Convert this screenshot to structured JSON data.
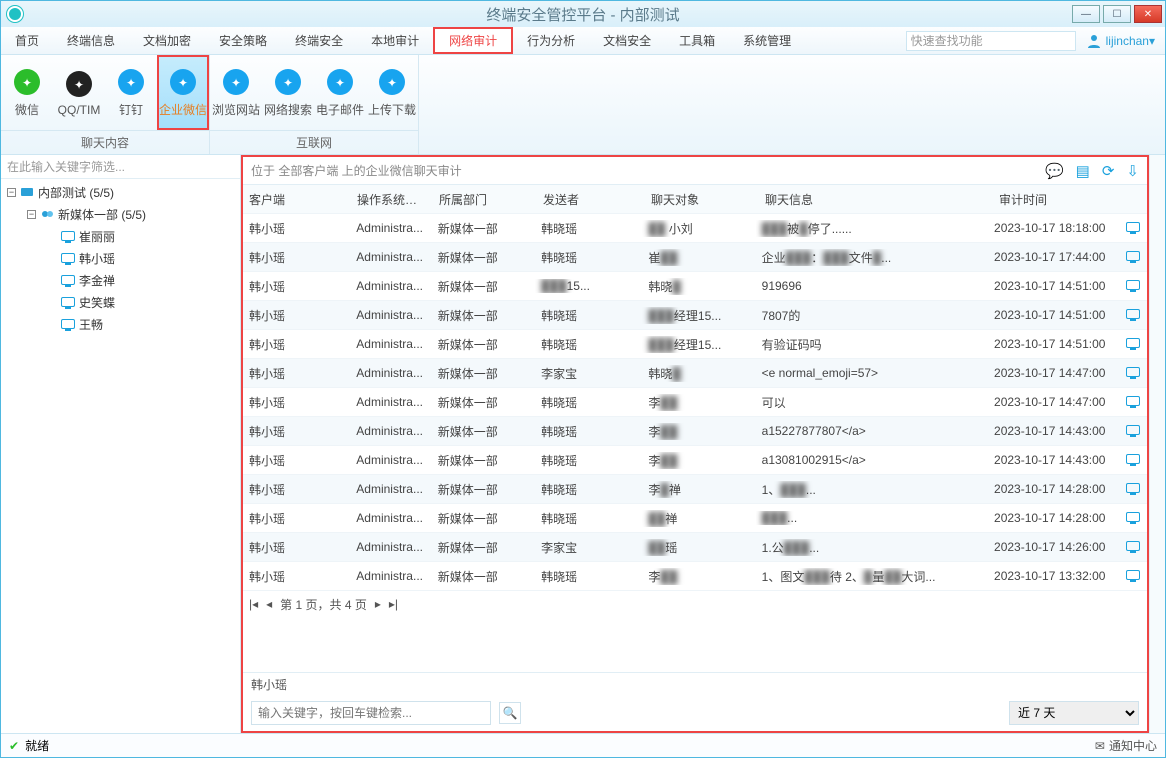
{
  "title": "终端安全管控平台 - 内部测试",
  "search_placeholder": "快速查找功能",
  "user": "lijinchan",
  "menu": [
    "首页",
    "终端信息",
    "文档加密",
    "安全策略",
    "终端安全",
    "本地审计",
    "网络审计",
    "行为分析",
    "文档安全",
    "工具箱",
    "系统管理"
  ],
  "menu_active": 6,
  "ribbon": {
    "group1": {
      "label": "聊天内容",
      "tools": [
        {
          "name": "wechat",
          "label": "微信",
          "color": "#2bbd2b"
        },
        {
          "name": "qq",
          "label": "QQ/TIM",
          "color": "#222"
        },
        {
          "name": "dingding",
          "label": "钉钉",
          "color": "#18a4ef"
        },
        {
          "name": "wecom",
          "label": "企业微信",
          "color": "#18a4ef",
          "active": true
        }
      ]
    },
    "group2": {
      "label": "互联网",
      "tools": [
        {
          "name": "browse",
          "label": "浏览网站",
          "color": "#18a4ef"
        },
        {
          "name": "websearch",
          "label": "网络搜索",
          "color": "#18a4ef"
        },
        {
          "name": "email",
          "label": "电子邮件",
          "color": "#18a4ef"
        },
        {
          "name": "updown",
          "label": "上传下载",
          "color": "#18a4ef"
        }
      ]
    }
  },
  "sidebar": {
    "filter": "在此输入关键字筛选...",
    "root": {
      "label": "内部测试 (5/5)"
    },
    "group": {
      "label": "新媒体一部 (5/5)"
    },
    "leaves": [
      "崔丽丽",
      "韩小瑶",
      "李金禅",
      "史笑蝶",
      "王畅"
    ]
  },
  "crumb": "位于 全部客户端 上的企业微信聊天审计",
  "cols": [
    "客户端",
    "操作系统账户",
    "所属部门",
    "发送者",
    "聊天对象",
    "聊天信息",
    "审计时间"
  ],
  "rows": [
    {
      "c": "韩小瑶",
      "o": "Administra...",
      "d": "新媒体一部",
      "s": "韩晓瑶",
      "t": "▇▇  小刘",
      "m": "▇▇▇▇▇▇▇▇▇被▇停了......",
      "tm": "2023-10-17 18:18:00"
    },
    {
      "c": "韩小瑶",
      "o": "Administra...",
      "d": "新媒体一部",
      "s": "韩晓瑶",
      "t": "崔▇▇",
      "m": "企业▇▇▇：▇▇▇▇▇文件▇...",
      "tm": "2023-10-17 17:44:00"
    },
    {
      "c": "韩小瑶",
      "o": "Administra...",
      "d": "新媒体一部",
      "s": "▇▇▇▇▇15...",
      "t": "韩晓▇",
      "m": "919696",
      "tm": "2023-10-17 14:51:00"
    },
    {
      "c": "韩小瑶",
      "o": "Administra...",
      "d": "新媒体一部",
      "s": "韩晓瑶",
      "t": "▇▇▇经理15...",
      "m": "7807的",
      "tm": "2023-10-17 14:51:00"
    },
    {
      "c": "韩小瑶",
      "o": "Administra...",
      "d": "新媒体一部",
      "s": "韩晓瑶",
      "t": "▇▇▇经理15...",
      "m": "有验证码吗",
      "tm": "2023-10-17 14:51:00"
    },
    {
      "c": "韩小瑶",
      "o": "Administra...",
      "d": "新媒体一部",
      "s": "李家宝",
      "t": "韩晓▇",
      "m": "<e normal_emoji=57>",
      "tm": "2023-10-17 14:47:00"
    },
    {
      "c": "韩小瑶",
      "o": "Administra...",
      "d": "新媒体一部",
      "s": "韩晓瑶",
      "t": "李▇▇",
      "m": "可以",
      "tm": "2023-10-17 14:47:00"
    },
    {
      "c": "韩小瑶",
      "o": "Administra...",
      "d": "新媒体一部",
      "s": "韩晓瑶",
      "t": "李▇▇",
      "m": "a15227877807</a>",
      "tm": "2023-10-17 14:43:00"
    },
    {
      "c": "韩小瑶",
      "o": "Administra...",
      "d": "新媒体一部",
      "s": "韩晓瑶",
      "t": "李▇▇",
      "m": "a13081002915</a>",
      "tm": "2023-10-17 14:43:00"
    },
    {
      "c": "韩小瑶",
      "o": "Administra...",
      "d": "新媒体一部",
      "s": "韩晓瑶",
      "t": "李▇禅",
      "m": "1、▇▇▇▇▇▇▇▇▇▇▇▇...",
      "tm": "2023-10-17 14:28:00"
    },
    {
      "c": "韩小瑶",
      "o": "Administra...",
      "d": "新媒体一部",
      "s": "韩晓瑶",
      "t": "▇▇禅",
      "m": "▇▇▇▇▇▇▇▇▇▇▇▇▇...",
      "tm": "2023-10-17 14:28:00"
    },
    {
      "c": "韩小瑶",
      "o": "Administra...",
      "d": "新媒体一部",
      "s": "李家宝",
      "t": "▇▇瑶",
      "m": "1.公▇▇▇▇▇▇▇▇▇...",
      "tm": "2023-10-17 14:26:00"
    },
    {
      "c": "韩小瑶",
      "o": "Administra...",
      "d": "新媒体一部",
      "s": "韩晓瑶",
      "t": "李▇▇",
      "m": "1、图文▇▇▇▇待  2、▇量▇▇大词...",
      "tm": "2023-10-17 13:32:00"
    }
  ],
  "pager": "第 1 页，共 4 页",
  "detail_name": "韩小瑶",
  "detail_search": "输入关键字，按回车键检索...",
  "range": "近 7 天",
  "status": "就绪",
  "notif": "通知中心"
}
